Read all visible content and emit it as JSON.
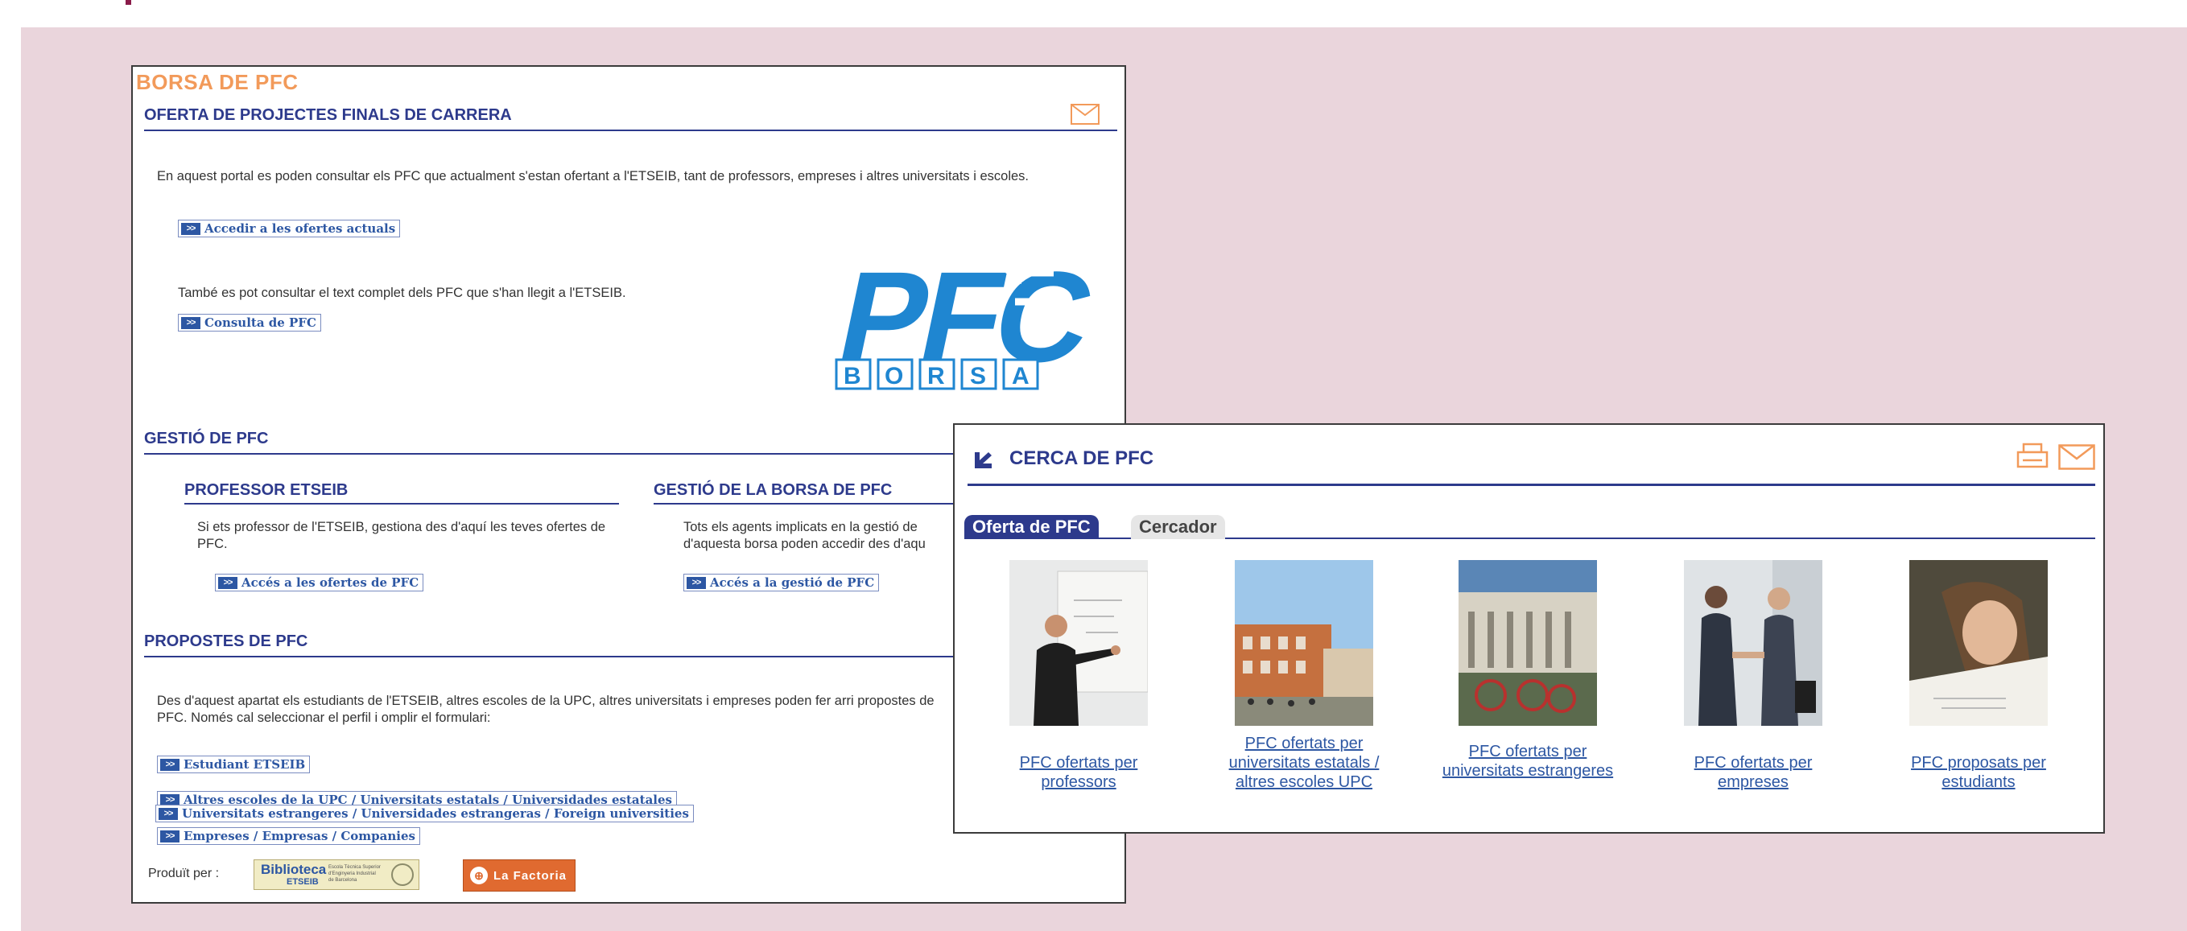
{
  "colors": {
    "accent": "#2d3a8c",
    "link": "#2d57a3",
    "brand_orange": "#f29a5a",
    "backdrop": "#ead5dc"
  },
  "left": {
    "brand": "BORSA DE PFC",
    "oferta": {
      "heading": "OFERTA DE PROJECTES FINALS DE CARRERA",
      "intro": "En aquest portal es poden consultar els PFC que actualment s'estan ofertant a l'ETSEIB, tant de professors, empreses i altres universitats i escoles.",
      "link1": "Accedir a les ofertes actuals",
      "text2": "També es pot consultar el text complet dels PFC que s'han llegit a l'ETSEIB.",
      "link2": "Consulta de PFC",
      "logo_top": "PFC",
      "logo_bottom": "BORSA"
    },
    "gestio": {
      "heading": "GESTIÓ DE PFC",
      "col1": {
        "heading": "PROFESSOR ETSEIB",
        "text": "Si ets professor de l'ETSEIB, gestiona des d'aquí les teves ofertes de PFC.",
        "link": "Accés a les ofertes de PFC"
      },
      "col2": {
        "heading": "GESTIÓ DE LA BORSA DE PFC",
        "text": "Tots els agents implicats en la gestió de d'aquesta borsa poden accedir des d'aqu",
        "link": "Accés a la gestió de PFC"
      }
    },
    "propostes": {
      "heading": "PROPOSTES DE PFC",
      "text": "Des d'aquest apartat els estudiants de l'ETSEIB, altres escoles de la UPC, altres universitats i empreses poden fer arri propostes de PFC. Només cal seleccionar el perfil i omplir el formulari:",
      "links": [
        "Estudiant ETSEIB",
        "Altres escoles de la UPC / Universitats estatals / Universidades estatales",
        "Empreses / Empresas / Companies",
        "Universitats estrangeres / Universidades estrangeras / Foreign universities"
      ]
    },
    "footer": {
      "produit": "Produït per :",
      "biblio_name": "Biblioteca",
      "biblio_sub": "ETSEIB",
      "biblio_note": "Escola Tècnica Superior d'Enginyeria Industrial de Barcelona",
      "factoria": "La Factoria"
    },
    "link_arrow": ">>"
  },
  "right": {
    "title": "CERCA DE PFC",
    "tabs": [
      "Oferta de PFC",
      "Cercador"
    ],
    "cards": [
      {
        "caption": "PFC ofertats per professors",
        "icon": "professor-at-whiteboard-photo"
      },
      {
        "caption": "PFC ofertats per universitats estatals / altres escoles UPC",
        "icon": "university-building-photo"
      },
      {
        "caption": "PFC ofertats per universitats estrangeres",
        "icon": "foreign-university-bicycles-photo"
      },
      {
        "caption": "PFC ofertats per empreses",
        "icon": "business-handshake-photo"
      },
      {
        "caption": "PFC proposats per estudiants",
        "icon": "student-studying-photo"
      }
    ]
  }
}
